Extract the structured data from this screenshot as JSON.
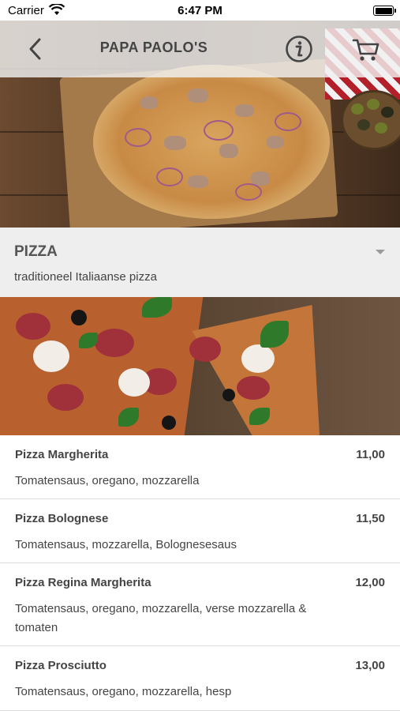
{
  "status_bar": {
    "carrier": "Carrier",
    "time": "6:47 PM",
    "wifi_icon": "wifi-icon",
    "battery_icon": "battery-icon"
  },
  "nav": {
    "title": "PAPA PAOLO'S",
    "back_icon": "chevron-left-icon",
    "info_icon": "info-icon",
    "cart_icon": "cart-icon"
  },
  "category": {
    "title": "PIZZA",
    "subtitle": "traditioneel Italiaanse pizza",
    "chevron_icon": "chevron-down-icon"
  },
  "menu_items": [
    {
      "name": "Pizza Margherita",
      "price": "11,00",
      "description": "Tomatensaus, oregano, mozzarella"
    },
    {
      "name": "Pizza Bolognese",
      "price": "11,50",
      "description": "Tomatensaus, mozzarella, Bolognesesaus"
    },
    {
      "name": "Pizza Regina Margherita",
      "price": "12,00",
      "description": "Tomatensaus, oregano, mozzarella, verse mozzarella & tomaten"
    },
    {
      "name": "Pizza Prosciutto",
      "price": "13,00",
      "description": "Tomatensaus, oregano, mozzarella, hesp"
    }
  ],
  "colors": {
    "nav_background": "#f0f0f0",
    "category_background": "#eeeeee",
    "text": "#444444",
    "divider": "#dcdcdc"
  }
}
